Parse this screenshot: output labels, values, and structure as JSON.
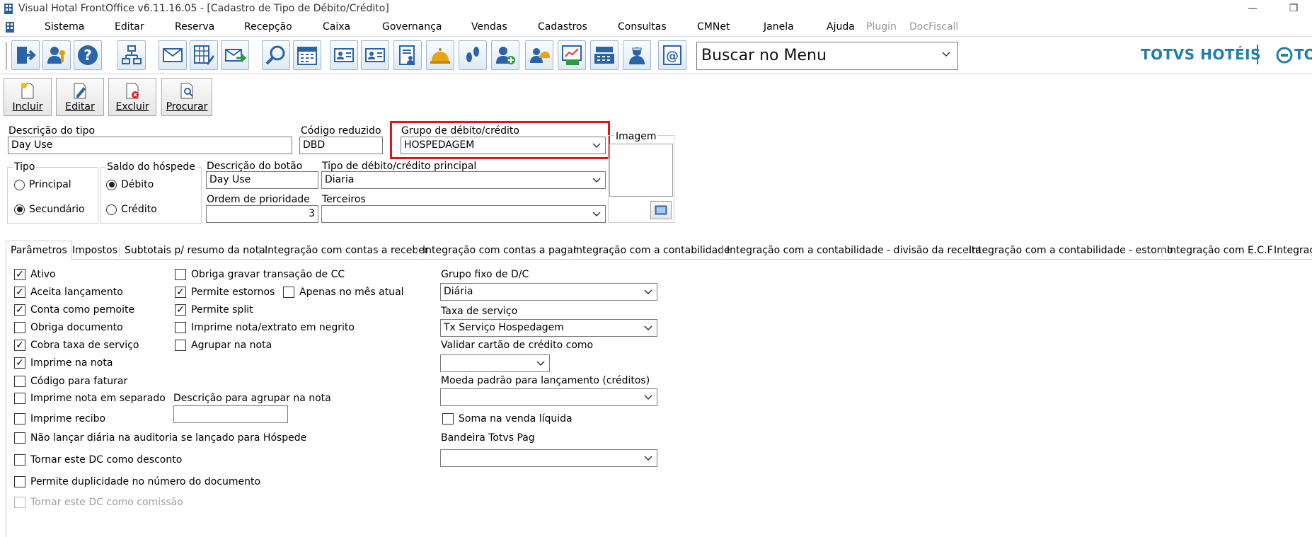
{
  "window": {
    "title": "Visual Hotal FrontOffice v6.11.16.05 - [Cadastro de Tipo de Débito/Crédito]"
  },
  "menubar": {
    "items": [
      {
        "label": "Sistema",
        "enabled": true
      },
      {
        "label": "Editar",
        "enabled": true
      },
      {
        "label": "Reserva",
        "enabled": true
      },
      {
        "label": "Recepção",
        "enabled": true
      },
      {
        "label": "Caixa",
        "enabled": true
      },
      {
        "label": "Governança",
        "enabled": true
      },
      {
        "label": "Vendas",
        "enabled": true
      },
      {
        "label": "Cadastros",
        "enabled": true
      },
      {
        "label": "Consultas",
        "enabled": true
      },
      {
        "label": "CMNet",
        "enabled": true
      },
      {
        "label": "Janela",
        "enabled": true
      },
      {
        "label": "Ajuda",
        "enabled": true
      },
      {
        "label": "Plugin",
        "enabled": false
      },
      {
        "label": "DocFiscall",
        "enabled": false
      }
    ]
  },
  "toolbar": {
    "search_value": "Buscar no Menu",
    "brand": "TOTVS HOTÉIS",
    "brand_secondary": "TO"
  },
  "actions": {
    "incluir": "Incluir",
    "editar": "Editar",
    "excluir": "Excluir",
    "procurar": "Procurar"
  },
  "form": {
    "descricao_tipo": {
      "label": "Descrição do tipo",
      "value": "Day Use"
    },
    "codigo_reduzido": {
      "label": "Código reduzido",
      "value": "DBD"
    },
    "grupo_dc": {
      "label": "Grupo de débito/crédito",
      "value": "HOSPEDAGEM"
    },
    "imagem": {
      "label": "Imagem"
    },
    "tipo": {
      "label": "Tipo",
      "options": [
        "Principal",
        "Secundário"
      ],
      "selected": "Secundário"
    },
    "saldo": {
      "label": "Saldo do hóspede",
      "options": [
        "Débito",
        "Crédito"
      ],
      "selected": "Débito"
    },
    "descricao_botao": {
      "label": "Descrição do botão",
      "value": "Day Use"
    },
    "tipo_dc_principal": {
      "label": "Tipo de débito/crédito principal",
      "value": "Diaria"
    },
    "ordem_prioridade": {
      "label": "Ordem de prioridade",
      "value": "3"
    },
    "terceiros": {
      "label": "Terceiros",
      "value": ""
    }
  },
  "tabs": [
    {
      "label": "Parâmetros",
      "active": true
    },
    {
      "label": "Impostos",
      "active": false
    },
    {
      "label": "Subtotais p/ resumo da nota",
      "active": false
    },
    {
      "label": "Integração com contas a receber",
      "active": false
    },
    {
      "label": "Integração com contas a pagar",
      "active": false
    },
    {
      "label": "Integração com a contabilidade",
      "active": false
    },
    {
      "label": "Integração com a contabilidade - divisão da receita",
      "active": false
    },
    {
      "label": "Integração com a contabilidade - estorno",
      "active": false
    },
    {
      "label": "Integração com E.C.F",
      "active": false
    },
    {
      "label": "Integraç",
      "active": false
    }
  ],
  "params": {
    "col1": [
      {
        "label": "Ativo",
        "checked": true
      },
      {
        "label": "Aceita lançamento",
        "checked": true
      },
      {
        "label": "Conta como pernoite",
        "checked": true
      },
      {
        "label": "Obriga documento",
        "checked": false
      },
      {
        "label": "Cobra taxa de serviço",
        "checked": true
      },
      {
        "label": "Imprime na nota",
        "checked": true
      },
      {
        "label": "Código para faturar",
        "checked": false
      },
      {
        "label": "Imprime nota em separado",
        "checked": false
      },
      {
        "label": "Imprime recibo",
        "checked": false
      },
      {
        "label": "Não lançar diária na auditoria se lançado para Hóspede",
        "checked": false
      },
      {
        "label": "Tornar este DC como desconto",
        "checked": false
      },
      {
        "label": "Permite duplicidade no número do documento",
        "checked": false
      },
      {
        "label": "Tornar este DC como comissão",
        "checked": false,
        "disabled": true
      }
    ],
    "col2": [
      {
        "label": "Obriga gravar transação de CC",
        "checked": false
      },
      {
        "label": "Permite estornos",
        "checked": true
      },
      {
        "label": "Apenas no mês atual",
        "checked": false
      },
      {
        "label": "Permite split",
        "checked": true
      },
      {
        "label": "Imprime nota/extrato em negrito",
        "checked": false
      },
      {
        "label": "Agrupar na nota",
        "checked": false
      }
    ],
    "descricao_agrupar": {
      "label": "Descrição para agrupar na nota",
      "value": ""
    },
    "grupo_fixo": {
      "label": "Grupo fixo de D/C",
      "value": "Diária"
    },
    "taxa_servico": {
      "label": "Taxa de serviço",
      "value": "Tx Serviço Hospedagem"
    },
    "validar_cartao": {
      "label": "Validar cartão de crédito como",
      "value": ""
    },
    "moeda_padrao": {
      "label": "Moeda padrão para lançamento (créditos)",
      "value": ""
    },
    "soma_venda": {
      "label": "Soma na venda líquida",
      "checked": false
    },
    "bandeira": {
      "label": "Bandeira Totvs Pag",
      "value": ""
    }
  },
  "colors": {
    "highlight": "#e31414",
    "brand": "#1f7fa8"
  }
}
